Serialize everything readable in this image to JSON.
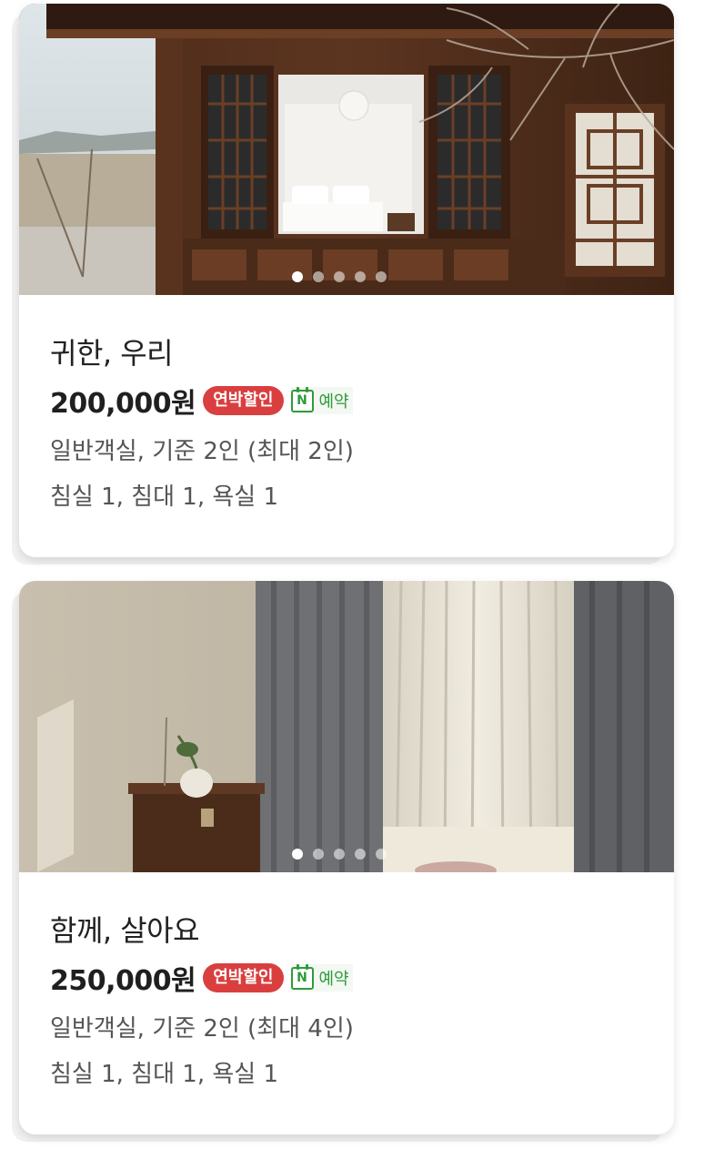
{
  "rooms": [
    {
      "name": "귀한, 우리",
      "price": "200,000원",
      "badge": "연박할인",
      "booking_icon": "N",
      "booking_label": "예약",
      "type": "일반객실, 기준 2인 (최대 2인)",
      "spec": "침실 1, 침대 1, 욕실 1",
      "photo_icon": "hanok-bedroom-photo",
      "carousel": {
        "total": 5,
        "active": 1
      }
    },
    {
      "name": "함께, 살아요",
      "price": "250,000원",
      "badge": "연박할인",
      "booking_icon": "N",
      "booking_label": "예약",
      "type": "일반객실, 기준 2인 (최대 4인)",
      "spec": "침실 1, 침대 1, 욕실 1",
      "photo_icon": "curtain-room-photo",
      "carousel": {
        "total": 5,
        "active": 1
      }
    }
  ],
  "colors": {
    "badge": "#d93f3f",
    "naver_green": "#2e9b3a",
    "text_primary": "#222222",
    "text_secondary": "#555555"
  }
}
